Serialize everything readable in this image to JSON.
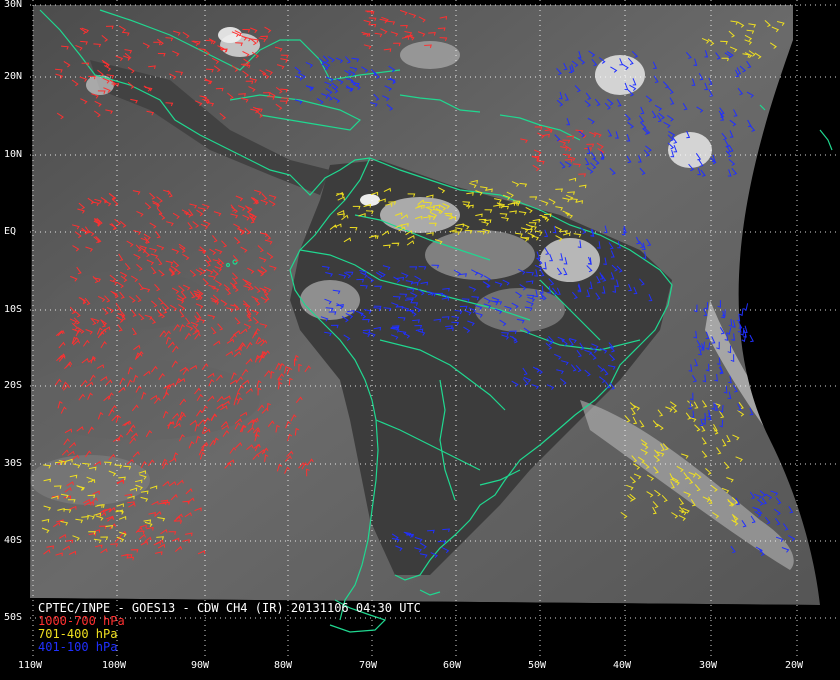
{
  "caption": {
    "title": "CPTEC/INPE - GOES13 - CDW CH4 (IR) 20131106 04:30 UTC",
    "legend": [
      {
        "label": "1000-700 hPa",
        "color": "#ff3030"
      },
      {
        "label": "701-400 hPa",
        "color": "#f0e020"
      },
      {
        "label": "401-100 hPa",
        "color": "#2030ff"
      }
    ]
  },
  "lat_labels": [
    "30N",
    "20N",
    "10N",
    "EQ",
    "10S",
    "20S",
    "30S",
    "40S",
    "50S"
  ],
  "lon_labels": [
    "110W",
    "100W",
    "90W",
    "80W",
    "70W",
    "60W",
    "50W",
    "40W",
    "30W",
    "20W"
  ],
  "colors": {
    "background": "#000000",
    "coastline": "#20d890",
    "gridlines": "#ffffff",
    "ocean_ir": "#5a5a5a"
  }
}
